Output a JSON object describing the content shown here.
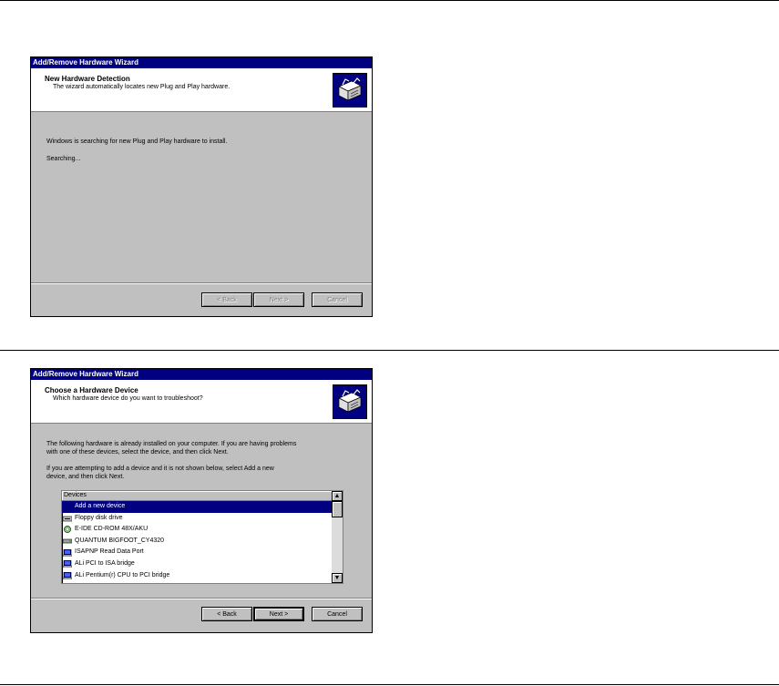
{
  "wizard1": {
    "title": "Add/Remove Hardware Wizard",
    "header_title": "New Hardware Detection",
    "header_subtitle": "The wizard automatically locates new Plug and Play hardware.",
    "line1": "Windows is searching for new Plug and Play hardware to install.",
    "line2": "Searching...",
    "buttons": {
      "back": "< Back",
      "next": "Next >",
      "cancel": "Cancel"
    }
  },
  "wizard2": {
    "title": "Add/Remove Hardware Wizard",
    "header_title": "Choose a Hardware Device",
    "header_subtitle": "Which hardware device do you want to troubleshoot?",
    "para1_line1": "The following hardware is already installed on your computer. If you are having problems",
    "para1_line2": "with one of these devices, select the device, and then click Next.",
    "para2_line1": "If you are attempting to add a device and it is not shown below, select Add a new",
    "para2_line2": "device, and then click Next.",
    "list_header": "Devices",
    "devices": [
      {
        "label": "Add a new device",
        "icon": "none"
      },
      {
        "label": "Floppy disk drive",
        "icon": "floppy-drive-icon"
      },
      {
        "label": "E-IDE CD-ROM 48X/AKU",
        "icon": "cdrom-icon"
      },
      {
        "label": "QUANTUM BIGFOOT_CY4320",
        "icon": "hard-disk-icon"
      },
      {
        "label": "ISAPNP Read Data Port",
        "icon": "computer-icon"
      },
      {
        "label": "ALi PCI to ISA bridge",
        "icon": "computer-icon"
      },
      {
        "label": "ALi Pentium(r) CPU to PCI bridge",
        "icon": "computer-icon"
      }
    ],
    "buttons": {
      "back": "< Back",
      "next": "Next >",
      "cancel": "Cancel"
    }
  }
}
